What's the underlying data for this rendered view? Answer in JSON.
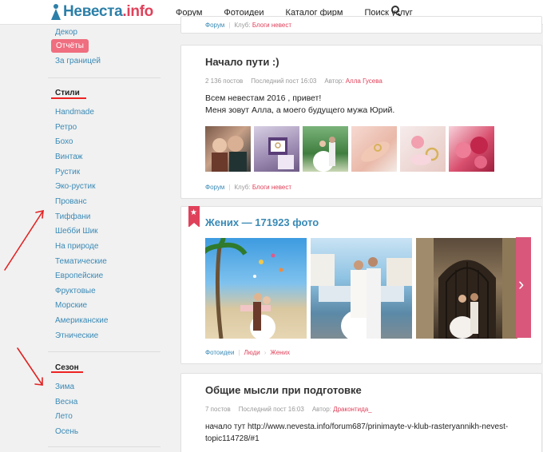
{
  "header": {
    "logo_main": "Невеста",
    "logo_suffix": ".info",
    "nav": [
      "Форум",
      "Фотоидеи",
      "Каталог фирм",
      "Поиск услуг"
    ],
    "search_icon": "search-icon"
  },
  "sidebar": {
    "top_items": [
      "Декор",
      "Отчёты",
      "За границей"
    ],
    "active_item": "Отчёты",
    "styles_heading": "Стили",
    "styles": [
      "Handmade",
      "Ретро",
      "Бохо",
      "Винтаж",
      "Рустик",
      "Эко-рустик",
      "Прованс",
      "Тиффани",
      "Шебби Шик",
      "На природе",
      "Тематические",
      "Европейские",
      "Фруктовые",
      "Морские",
      "Американские",
      "Этнические"
    ],
    "season_heading": "Сезон",
    "seasons": [
      "Зима",
      "Весна",
      "Лето",
      "Осень"
    ]
  },
  "annotation_color": "#e22222",
  "prev_card": {
    "forum": "Форум",
    "club_label": "Клуб:",
    "club": "Блоги невест"
  },
  "post1": {
    "title": "Начало пути :)",
    "posts": "2 136 постов",
    "last_post": "Последний пост 16:03",
    "author_label": "Автор:",
    "author": "Алла Гусева",
    "text_line1": "Всем невестам 2016 , привет!",
    "text_line2": "Меня зовут Алла, а моего будущего мужа Юрий.",
    "forum": "Форум",
    "club_label": "Клуб:",
    "club": "Блоги невест"
  },
  "gallery": {
    "title": "Жених — 171923 фото",
    "crumbs": [
      "Фотоидеи",
      "Люди",
      "Жених"
    ],
    "bookmark_icon": "bookmark-star-icon",
    "next_icon": "chevron-right-icon"
  },
  "post2": {
    "title": "Общие мысли при подготовке",
    "posts": "7 постов",
    "last_post": "Последний пост 16:03",
    "author_label": "Автор:",
    "author": "Драконтида_",
    "text_line1": "начало тут http://www.nevesta.info/forum687/prinimayte-v-klub-rasteryannikh-nevest-",
    "text_line2": "topic114728/#1"
  }
}
